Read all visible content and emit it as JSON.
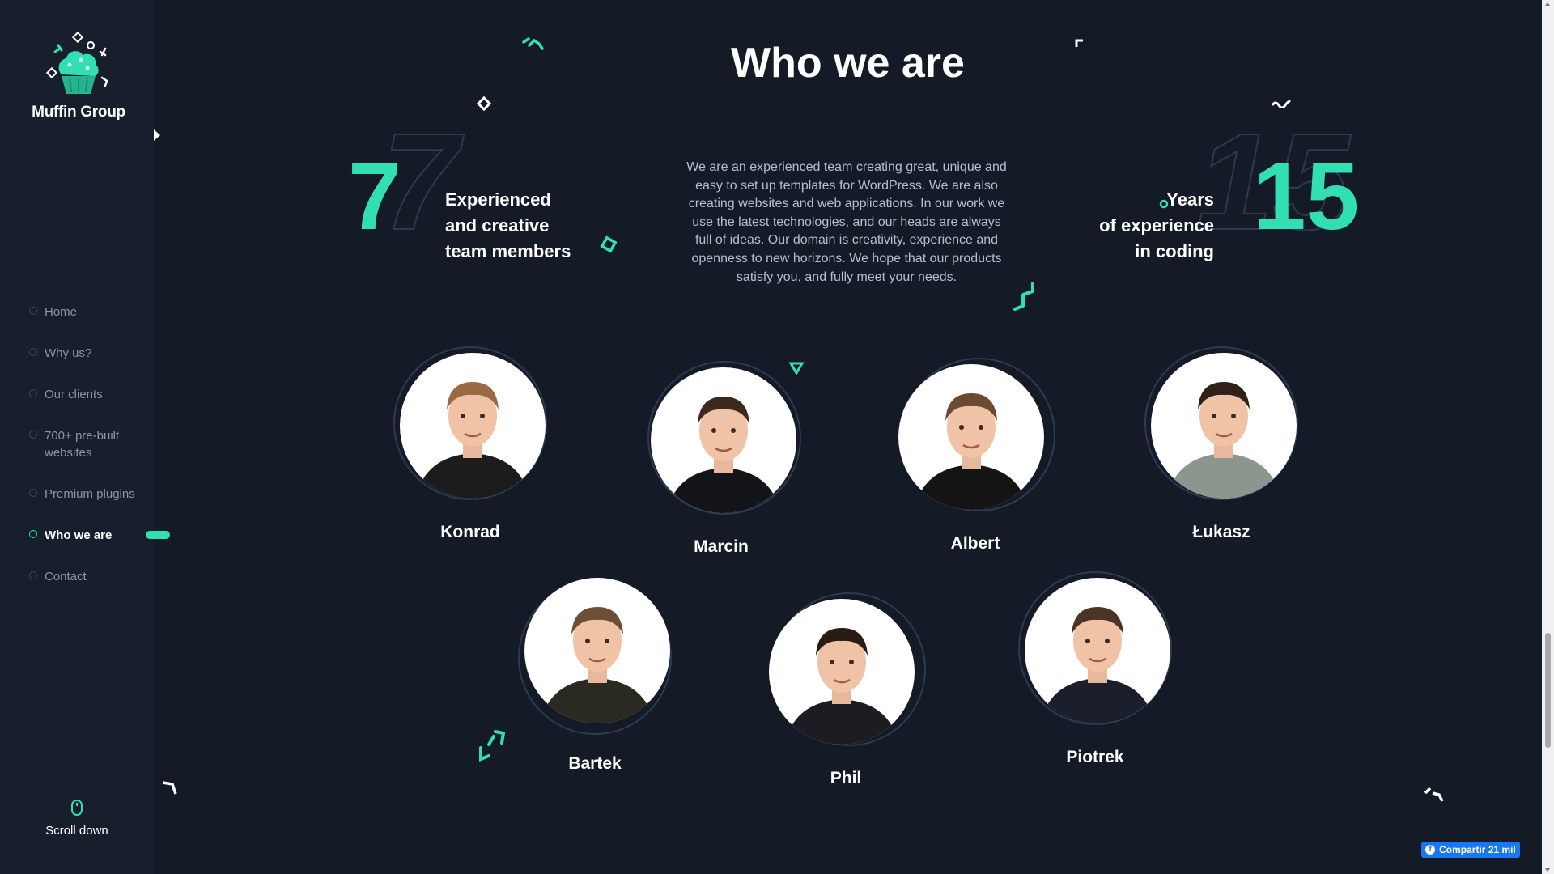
{
  "brand": {
    "name": "Muffin Group",
    "accent": "#32dfb3",
    "background": "#141b27"
  },
  "nav": {
    "items": [
      {
        "label": "Home",
        "active": false
      },
      {
        "label": "Why us?",
        "active": false
      },
      {
        "label": "Our clients",
        "active": false
      },
      {
        "label": "700+ pre-built websites",
        "active": false
      },
      {
        "label": "Premium plugins",
        "active": false
      },
      {
        "label": "Who we are",
        "active": true
      },
      {
        "label": "Contact",
        "active": false
      }
    ],
    "scroll_label": "Scroll down"
  },
  "section": {
    "title": "Who we are",
    "team_stat": {
      "value": "7",
      "line1": "Experienced",
      "line2": "and creative",
      "line3": "team members"
    },
    "years_stat": {
      "value": "15",
      "line1": "Years",
      "line2": "of experience",
      "line3": "in coding"
    },
    "about": "We are an experienced team creating great, unique and easy to set up templates for WordPress. We are also creating websites and web applications. In our work we use the latest technologies, and our heads are always full of ideas. Our domain is creativity, experience and openness to new horizons. We hope that our products satisfy you, and fully meet your needs."
  },
  "team": [
    {
      "name": "Konrad",
      "shirt": "#1c1c1c",
      "hair": "#9a6a45"
    },
    {
      "name": "Marcin",
      "shirt": "#121417",
      "hair": "#3d2a1f"
    },
    {
      "name": "Albert",
      "shirt": "#141414",
      "hair": "#6b4a33"
    },
    {
      "name": "Łukasz",
      "shirt": "#8d958f",
      "hair": "#2f2119"
    },
    {
      "name": "Bartek",
      "shirt": "#2b2a22",
      "hair": "#6d4f36"
    },
    {
      "name": "Phil",
      "shirt": "#1b1d22",
      "hair": "#2a1c14"
    },
    {
      "name": "Piotrek",
      "shirt": "#1a1f2b",
      "hair": "#4a3426"
    }
  ],
  "share": {
    "label": "Compartir 21 mil"
  }
}
